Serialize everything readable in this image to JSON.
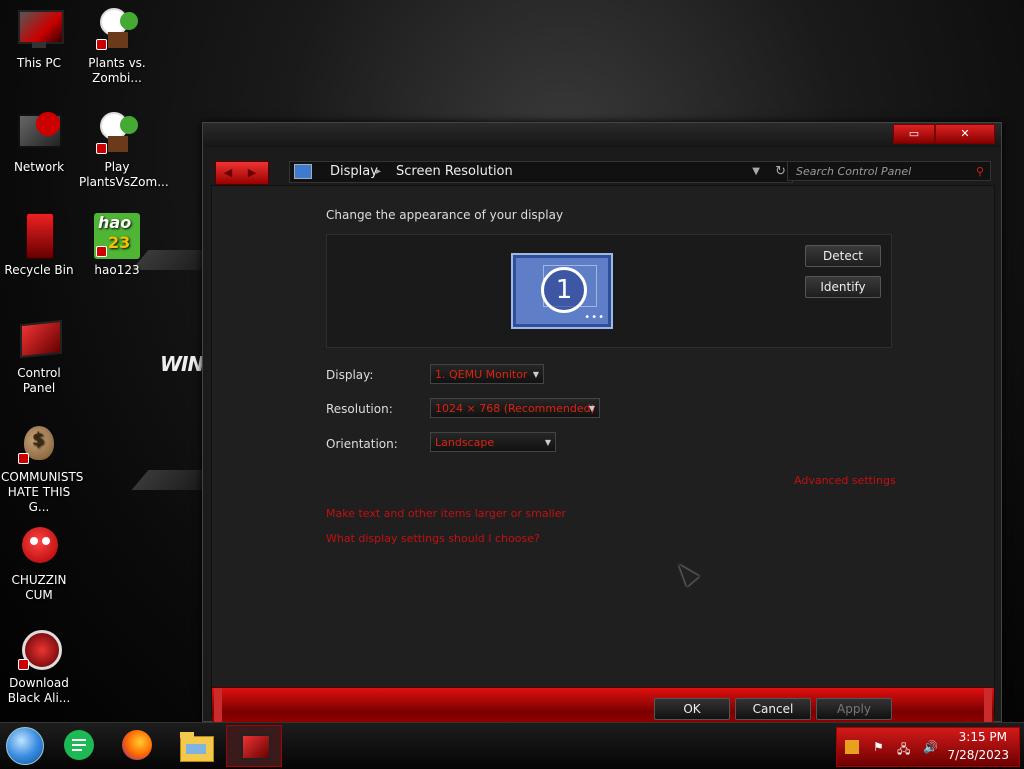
{
  "desktop": {
    "icons": [
      {
        "label": "This PC"
      },
      {
        "label": "Plants vs.\nZombi..."
      },
      {
        "label": "Network"
      },
      {
        "label": "Play\nPlantsVsZom..."
      },
      {
        "label": "Recycle Bin"
      },
      {
        "label": "hao123"
      },
      {
        "label": "Control Panel"
      },
      {
        "label": "COMMUNISTS\nHATE THIS G..."
      },
      {
        "label": "CHUZZIN\nCUM"
      },
      {
        "label": "Download\nBlack Ali..."
      }
    ],
    "hao_text_top": "hao",
    "hao_text_bottom": "23",
    "wallpaper_text": "WIND"
  },
  "window": {
    "address": {
      "crumb1": "Display",
      "separator": "▸",
      "crumb2": "Screen Resolution"
    },
    "search_placeholder": "Search Control Panel",
    "heading": "Change the appearance of your display",
    "monitor_number": "1",
    "detect_label": "Detect",
    "identify_label": "Identify",
    "fields": {
      "display_label": "Display:",
      "display_value": "1. QEMU Monitor",
      "resolution_label": "Resolution:",
      "resolution_value": "1024 × 768 (Recommended)",
      "orientation_label": "Orientation:",
      "orientation_value": "Landscape"
    },
    "advanced_link": "Advanced settings",
    "link_text_size": "Make text and other items larger or smaller",
    "link_help": "What display settings should I choose?",
    "ok_label": "OK",
    "cancel_label": "Cancel",
    "apply_label": "Apply",
    "restore_label": "▭",
    "close_label": "✕"
  },
  "taskbar": {
    "time": "3:15 PM",
    "date": "7/28/2023"
  },
  "colors": {
    "accent": "#cc1111",
    "link": "#c21010",
    "window_bg": "#1b1b1b"
  }
}
